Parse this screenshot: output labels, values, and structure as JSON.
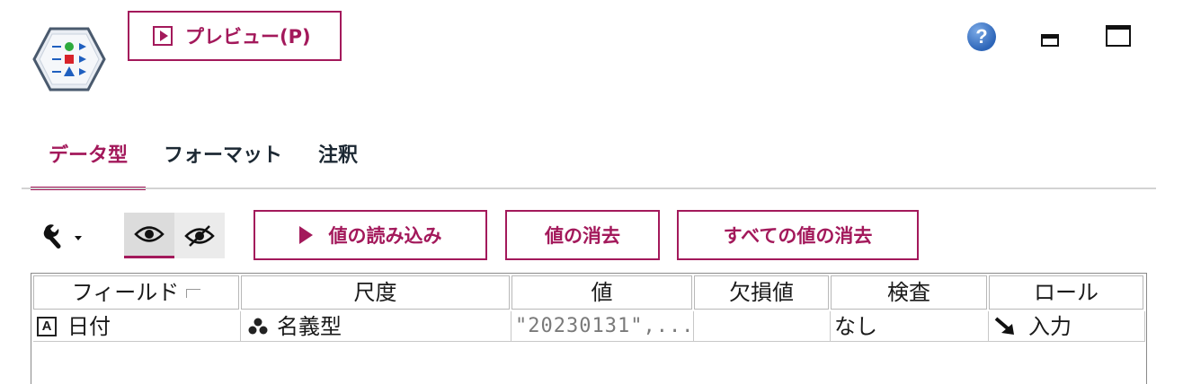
{
  "toolbar": {
    "preview_label": "プレビュー(P)",
    "help_symbol": "?"
  },
  "tabs": [
    {
      "label": "データ型",
      "active": true
    },
    {
      "label": "フォーマット",
      "active": false
    },
    {
      "label": "注釈",
      "active": false
    }
  ],
  "actions": {
    "read_values": "値の読み込み",
    "clear_values": "値の消去",
    "clear_all_values": "すべての値の消去"
  },
  "table": {
    "columns": [
      "フィールド",
      "尺度",
      "値",
      "欠損値",
      "検査",
      "ロール"
    ],
    "rows": [
      {
        "type_badge": "A",
        "field": "日付",
        "measure": "名義型",
        "value": "\"20230131\",...",
        "missing": "",
        "check": "なし",
        "role": "入力"
      }
    ]
  },
  "icons": {
    "node": "type-node-icon",
    "wrench": "wrench-icon",
    "eye_show": "eye-icon",
    "eye_hide": "eye-off-icon",
    "measure": "nominal-icon",
    "role": "arrow-input-icon"
  },
  "colors": {
    "accent": "#a3195b",
    "help": "#2d65b8"
  }
}
